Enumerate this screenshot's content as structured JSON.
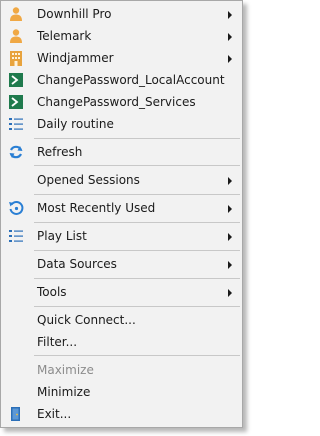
{
  "menu": {
    "items": [
      {
        "label": "Downhill Pro",
        "icon": "person-icon",
        "submenu": true
      },
      {
        "label": "Telemark",
        "icon": "person-icon",
        "submenu": true
      },
      {
        "label": "Windjammer",
        "icon": "building-icon",
        "submenu": true
      },
      {
        "label": "ChangePassword_LocalAccount",
        "icon": "powershell-icon",
        "submenu": false
      },
      {
        "label": "ChangePassword_Services",
        "icon": "powershell-icon",
        "submenu": false
      },
      {
        "label": "Daily routine",
        "icon": "list-icon",
        "submenu": false
      },
      {
        "label": "Refresh",
        "icon": "refresh-icon",
        "submenu": false
      },
      {
        "label": "Opened Sessions",
        "icon": null,
        "submenu": true
      },
      {
        "label": "Most Recently Used",
        "icon": "history-icon",
        "submenu": true
      },
      {
        "label": "Play List",
        "icon": "list-icon",
        "submenu": true
      },
      {
        "label": "Data Sources",
        "icon": null,
        "submenu": true
      },
      {
        "label": "Tools",
        "icon": null,
        "submenu": true
      },
      {
        "label": "Quick Connect...",
        "icon": null,
        "submenu": false
      },
      {
        "label": "Filter...",
        "icon": null,
        "submenu": false
      },
      {
        "label": "Maximize",
        "icon": null,
        "submenu": false,
        "disabled": true
      },
      {
        "label": "Minimize",
        "icon": null,
        "submenu": false
      },
      {
        "label": "Exit...",
        "icon": "exit-door-icon",
        "submenu": false
      }
    ]
  },
  "colors": {
    "menu_background": "#f2f2f2",
    "person_icon": "#f0a844",
    "building_icon": "#e8a33d",
    "powershell_icon": "#1f7a4d",
    "list_icon": "#2b6fb8",
    "refresh_icon": "#2a7fd4",
    "disabled_text": "#8c8c8c"
  }
}
